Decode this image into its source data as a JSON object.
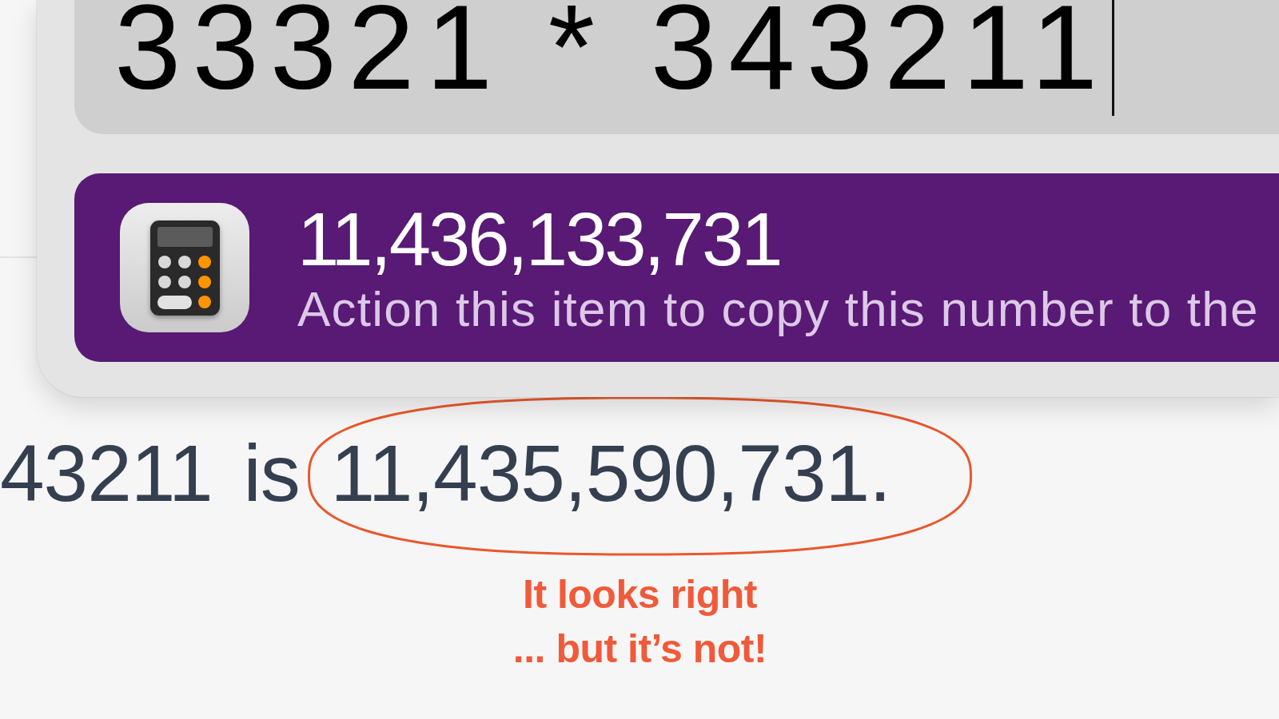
{
  "launcher": {
    "search": {
      "value": "33321 * 343211",
      "focused": true
    },
    "results": [
      {
        "kind": "calculator",
        "selected": true,
        "title": "11,436,133,731",
        "subtitle": "Action this item to copy this number to the"
      }
    ]
  },
  "page": {
    "sentence": "43211 is 11,435,590,731."
  },
  "annotation": {
    "note": "It looks right\n... but it’s not!"
  }
}
